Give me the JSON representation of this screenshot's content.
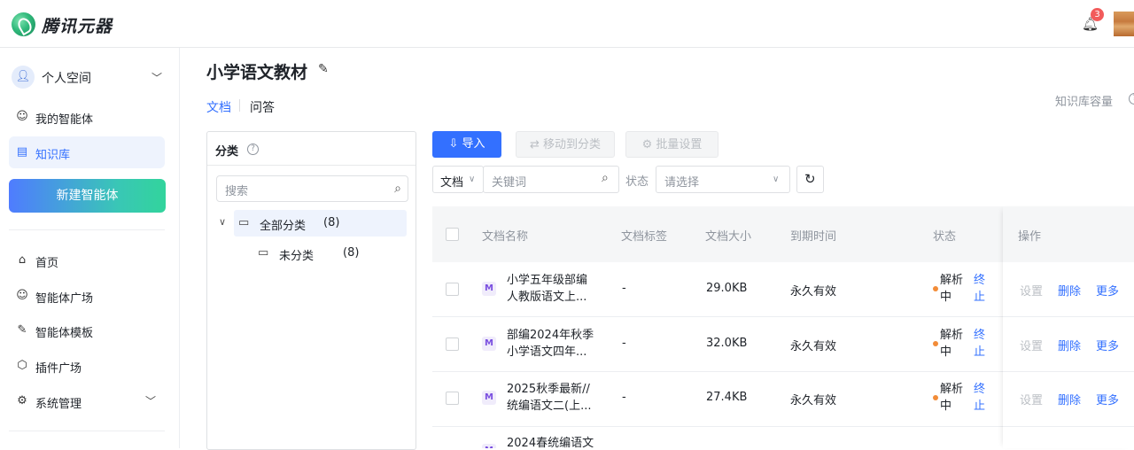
{
  "header": {
    "brand": "腾讯元器",
    "notification_count": "3"
  },
  "sidebar": {
    "space_label": "个人空间",
    "items": [
      {
        "label": "我的智能体",
        "icon": "robot-icon"
      },
      {
        "label": "知识库",
        "icon": "document-icon",
        "active": true
      }
    ],
    "new_agent_label": "新建智能体",
    "nav": [
      {
        "label": "首页",
        "icon": "home-icon"
      },
      {
        "label": "智能体广场",
        "icon": "robot-icon"
      },
      {
        "label": "智能体模板",
        "icon": "template-icon"
      },
      {
        "label": "插件广场",
        "icon": "cube-icon"
      },
      {
        "label": "系统管理",
        "icon": "gear-icon"
      }
    ]
  },
  "page": {
    "title": "小学语文教材",
    "tabs": [
      "文档",
      "问答"
    ],
    "capacity_label": "知识库容量"
  },
  "category": {
    "title": "分类",
    "search_placeholder": "搜索",
    "tree": [
      {
        "label": "全部分类",
        "count": "(8)"
      },
      {
        "label": "未分类",
        "count": "(8)"
      }
    ]
  },
  "toolbar": {
    "import_label": "导入",
    "move_label": "移动到分类",
    "batch_label": "批量设置",
    "type_select": "文档",
    "keyword_placeholder": "关键词",
    "status_label": "状态",
    "status_placeholder": "请选择"
  },
  "table": {
    "headers": [
      "文档名称",
      "文档标签",
      "文档大小",
      "到期时间",
      "状态",
      "操作"
    ],
    "rows": [
      {
        "name1": "小学五年级部编",
        "name2": "人教版语文上...",
        "tag": "-",
        "size": "29.0KB",
        "expire": "永久有效",
        "status1": "解析",
        "status2": "中",
        "stop1": "终",
        "stop2": "止"
      },
      {
        "name1": "部编2024年秋季",
        "name2": "小学语文四年...",
        "tag": "-",
        "size": "32.0KB",
        "expire": "永久有效",
        "status1": "解析",
        "status2": "中",
        "stop1": "终",
        "stop2": "止"
      },
      {
        "name1": "2025秋季最新//",
        "name2": "统编语文二(上...",
        "tag": "-",
        "size": "27.4KB",
        "expire": "永久有效",
        "status1": "解析",
        "status2": "中",
        "stop1": "终",
        "stop2": "止"
      },
      {
        "name1": "2024春统编语文",
        "name2": "",
        "tag": "",
        "size": "",
        "expire": "",
        "status1": "",
        "status2": "",
        "stop1": "",
        "stop2": ""
      }
    ],
    "ops": {
      "settings": "设置",
      "delete": "删除",
      "more": "更多"
    }
  }
}
